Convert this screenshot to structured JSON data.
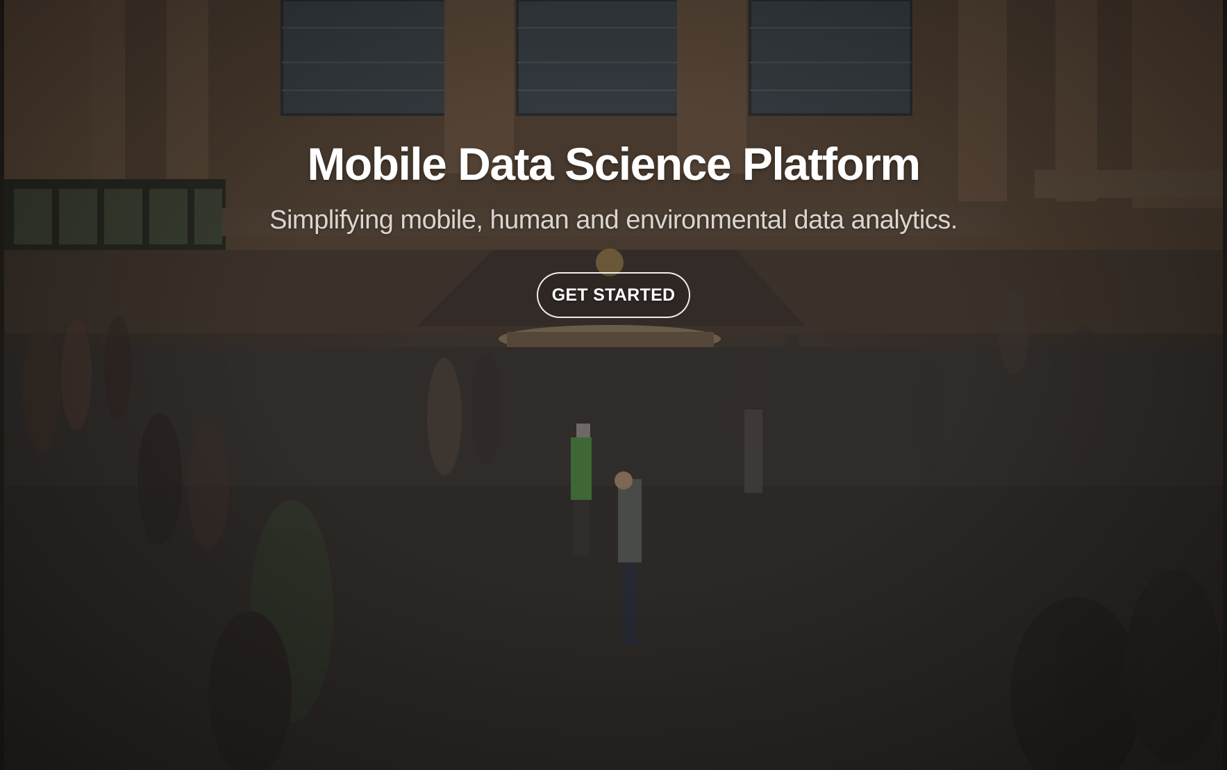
{
  "hero": {
    "title": "Mobile Data Science Platform",
    "subtitle": "Simplifying mobile, human and environmental data analytics.",
    "cta_label": "GET STARTED"
  },
  "colors": {
    "title_text": "#ffffff",
    "button_border": "#ffffff",
    "overlay": "#1b1815"
  }
}
